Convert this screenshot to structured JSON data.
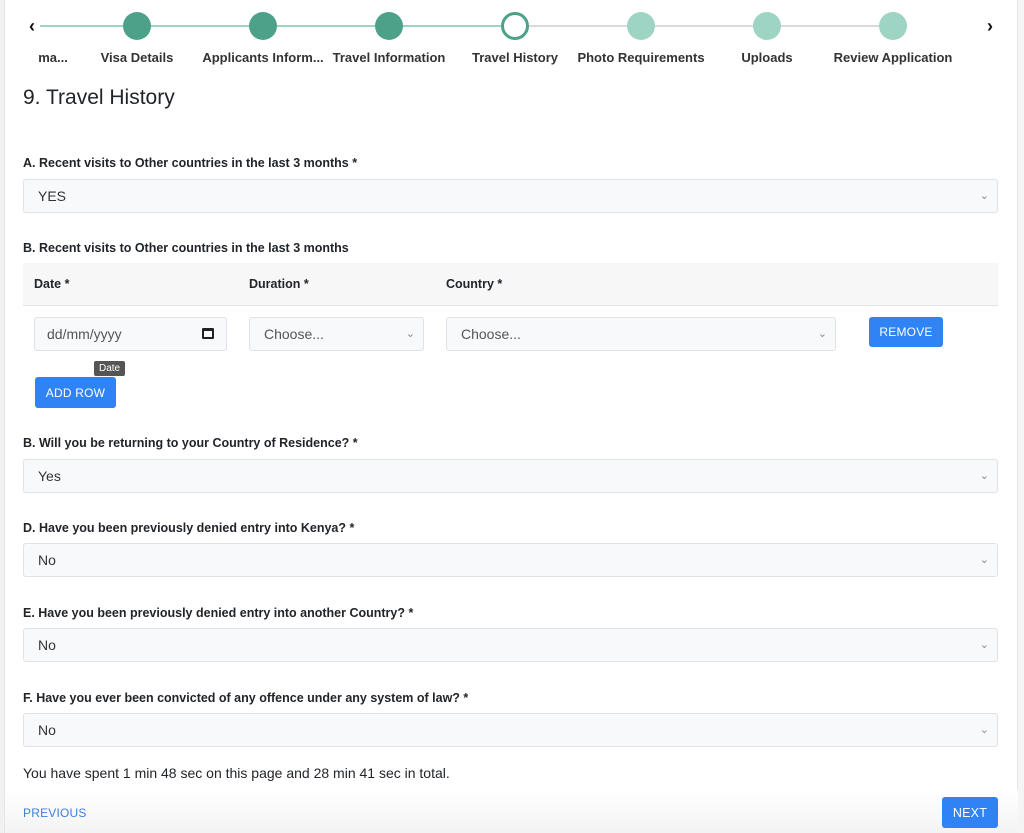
{
  "stepper": {
    "prev_icon": "chevron-left-icon",
    "next_icon": "chevron-right-icon",
    "prev_glyph": "‹",
    "next_glyph": "›",
    "steps": [
      {
        "label": "ma...",
        "state": "hidden-dot"
      },
      {
        "label": "Visa Details",
        "state": "done"
      },
      {
        "label": "Applicants Inform...",
        "state": "done"
      },
      {
        "label": "Travel Information",
        "state": "done"
      },
      {
        "label": "Travel History",
        "state": "current"
      },
      {
        "label": "Photo Requirements",
        "state": "todo"
      },
      {
        "label": "Uploads",
        "state": "todo"
      },
      {
        "label": "Review Application",
        "state": "todo"
      }
    ],
    "colors": {
      "done": "#4da189",
      "todo": "#9ed4c4",
      "line_done": "#9ed4c4",
      "line_todo": "#d9d9d9"
    }
  },
  "page": {
    "title": "9. Travel History"
  },
  "questions": {
    "a": {
      "label": "A. Recent visits to Other countries in the last 3 months *",
      "value": "YES"
    },
    "b_table": {
      "label": "B. Recent visits to Other countries in the last 3 months",
      "headers": {
        "date": "Date *",
        "duration": "Duration *",
        "country": "Country *"
      },
      "row": {
        "date_placeholder": "dd/mm/yyyy",
        "date_tooltip": "Date",
        "duration_value": "Choose...",
        "country_value": "Choose...",
        "remove_label": "REMOVE"
      },
      "add_row_label": "ADD ROW"
    },
    "b_return": {
      "label": "B. Will you be returning to your Country of Residence? *",
      "value": "Yes"
    },
    "d": {
      "label": "D. Have you been previously denied entry into Kenya? *",
      "value": "No"
    },
    "e": {
      "label": "E. Have you been previously denied entry into another Country? *",
      "value": "No"
    },
    "f": {
      "label": "F. Have you ever been convicted of any offence under any system of law? *",
      "value": "No"
    }
  },
  "timer": {
    "text": "You have spent 1 min 48 sec on this page and 28 min 41 sec in total."
  },
  "footer": {
    "previous_label": "PREVIOUS",
    "next_label": "NEXT"
  },
  "chevron_glyph": "⌄",
  "accent_color": "#3083f5"
}
